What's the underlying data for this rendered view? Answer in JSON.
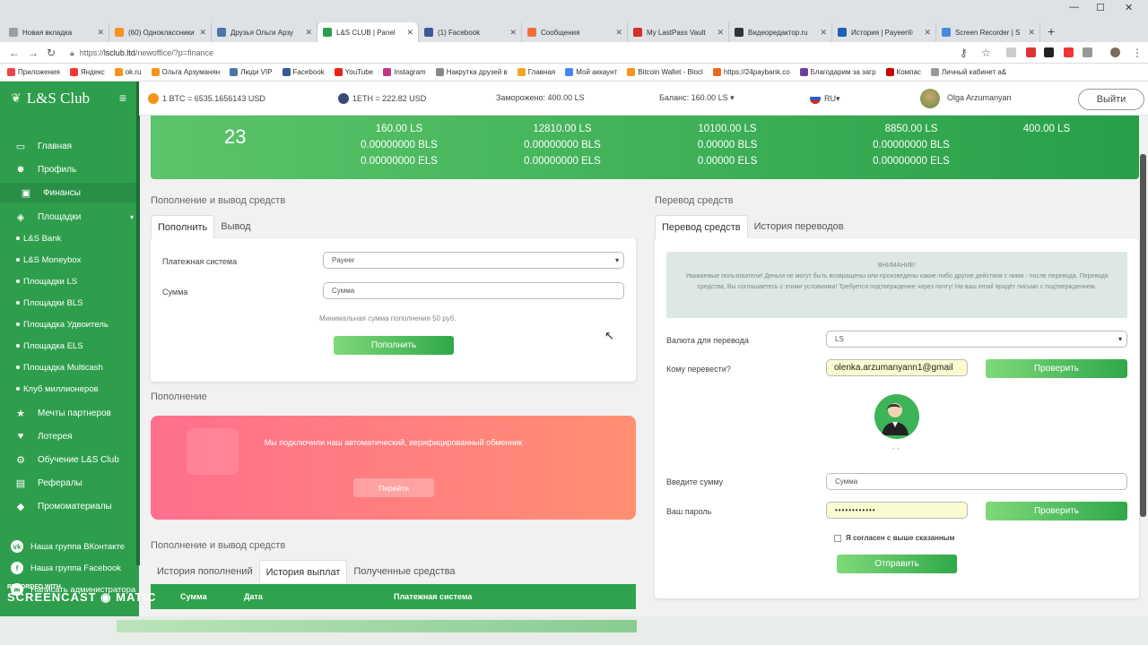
{
  "browser": {
    "tabs": [
      {
        "title": "Новая вкладка",
        "color": "#9e9e9e"
      },
      {
        "title": "(60) Одноклассники",
        "color": "#f7931e"
      },
      {
        "title": "Друзья Ольги Арзу",
        "color": "#4a76a8"
      },
      {
        "title": "L&S CLUB | Panel",
        "color": "#2e9e4d"
      },
      {
        "title": "(1) Facebook",
        "color": "#3b5998"
      },
      {
        "title": "Сообщения",
        "color": "#f36f3a"
      },
      {
        "title": "My LastPass Vault",
        "color": "#d32d27"
      },
      {
        "title": "Видеоредактор.ru",
        "color": "#333333"
      },
      {
        "title": "История | Payeer®",
        "color": "#1f5fb8"
      },
      {
        "title": "Screen Recorder | S",
        "color": "#4a8ad8"
      }
    ],
    "new_tab": "+",
    "url_prefix": "https://",
    "url_host": "lsclub.ltd",
    "url_path": "/newoffice/?p=finance",
    "bookmarks": [
      {
        "label": "Приложения",
        "color": "#e44"
      },
      {
        "label": "Яндекс",
        "color": "#f33"
      },
      {
        "label": "ok.ru",
        "color": "#f7931e"
      },
      {
        "label": "Ольга Арзуманян",
        "color": "#f7931e"
      },
      {
        "label": "Люди VIP",
        "color": "#4a76a8"
      },
      {
        "label": "Facebook",
        "color": "#3b5998"
      },
      {
        "label": "YouTube",
        "color": "#e62117"
      },
      {
        "label": "Instagram",
        "color": "#c13584"
      },
      {
        "label": "Накрутка друзей в",
        "color": "#888"
      },
      {
        "label": "Главная",
        "color": "#f5a623"
      },
      {
        "label": "Мой аккаунт",
        "color": "#4285f4"
      },
      {
        "label": "Bitcoin Wallet - Blocl",
        "color": "#f7931a"
      },
      {
        "label": "https://24paybank.co",
        "color": "#e86a1c"
      },
      {
        "label": "Благодарим за загр",
        "color": "#6b3fa0"
      },
      {
        "label": "Компас",
        "color": "#c00"
      },
      {
        "label": "Личный кабинет a&",
        "color": "#999"
      }
    ]
  },
  "app": {
    "logo": "L&S Club",
    "menu": [
      {
        "label": "Главная",
        "icon": "monitor-icon",
        "glyph": "▭"
      },
      {
        "label": "Профиль",
        "icon": "user-icon",
        "glyph": "☻"
      },
      {
        "label": "Финансы",
        "icon": "wallet-icon",
        "glyph": "▣"
      },
      {
        "label": "Площадки",
        "icon": "layers-icon",
        "glyph": "◈"
      }
    ],
    "submenu": [
      "L&S Bank",
      "L&S Moneybox",
      "Площадки LS",
      "Площадки BLS",
      "Площадка Удвоитель",
      "Площадка ELS",
      "Площадка Multicash",
      "Клуб миллионеров"
    ],
    "menu2": [
      {
        "label": "Мечты партнеров",
        "icon": "star-icon",
        "glyph": "★"
      },
      {
        "label": "Лотерея",
        "icon": "heart-icon",
        "glyph": "♥"
      },
      {
        "label": "Обучение L&S Club",
        "icon": "gear-icon",
        "glyph": "⚙"
      },
      {
        "label": "Рефералы",
        "icon": "users-icon",
        "glyph": "▤"
      },
      {
        "label": "Промоматериалы",
        "icon": "tag-icon",
        "glyph": "◆"
      }
    ],
    "social": [
      {
        "label": "Наша группа ВКонтакте",
        "icon": "vk-icon",
        "glyph": "vk"
      },
      {
        "label": "Наша группа Facebook",
        "icon": "facebook-icon",
        "glyph": "f"
      },
      {
        "label": "Написать администратора",
        "icon": "chat-icon",
        "glyph": "✉"
      }
    ]
  },
  "header": {
    "btc": "1 BTC = 6535.1656143 USD",
    "eth": "1ETH = 222.82 USD",
    "frozen": "Заморожено: 400.00 LS",
    "balance": "Баланс: 160.00 LS ▾",
    "lang": "RU▾",
    "user": "Olga Arzumanyan",
    "logout": "Выйти"
  },
  "stats": {
    "count": "23",
    "columns": [
      [
        "160.00 LS",
        "0.00000000 BLS",
        "0.00000000 ELS"
      ],
      [
        "12810.00 LS",
        "0.00000000 BLS",
        "0.00000000 ELS"
      ],
      [
        "10100.00 LS",
        "0.00000 BLS",
        "0.00000 ELS"
      ],
      [
        "8850.00 LS",
        "0.00000000 BLS",
        "0.00000000 ELS"
      ],
      [
        "400.00 LS",
        "",
        ""
      ]
    ]
  },
  "deposit": {
    "section_title": "Пополнение и вывод средств",
    "tab_deposit": "Пополнить",
    "tab_withdraw": "Вывод",
    "payment_label": "Платежная система",
    "payment_value": "Payeer",
    "amount_label": "Сумма",
    "amount_placeholder": "Сумма",
    "min_note": "Минимальная сумма пополнения 50 руб.",
    "submit": "Пополнить"
  },
  "exchanger": {
    "section_title": "Пополнение",
    "message": "Мы подключили наш автоматический, верифицированный обменник",
    "button": "Перейти"
  },
  "history": {
    "section_title": "Пополнение и вывод средств",
    "tabs": [
      "История пополнений",
      "История выплат",
      "Полученные средства"
    ],
    "columns": [
      "Сумма",
      "Дата",
      "Платежная система"
    ]
  },
  "transfer": {
    "section_title": "Перевод средств",
    "tab_transfer": "Перевод средств",
    "tab_history": "История переводов",
    "warn_title": "ВНИМАНИЕ!",
    "warn_text": "Уважаемые пользователи! Деньги не могут быть возвращены или произведены какие-либо другие действия с ними - после перевода. Переводя средства, Вы соглашаетесь с этими условиями! Требуется подтверждение через почту! На ваш email придёт письмо с подтверждением.",
    "currency_label": "Валюта для перевода",
    "currency_value": "LS",
    "to_label": "Кому перевести?",
    "to_value": "olenka.arzumanyann1@gmail",
    "check": "Проверить",
    "recipient_name": "- -",
    "amount_label": "Введите сумму",
    "amount_placeholder": "Сумма",
    "password_label": "Ваш пароль",
    "password_value": "••••••••••••",
    "check2": "Проверить",
    "agree": "Я согласен с выше сказанным",
    "send": "Отправить"
  },
  "watermark": {
    "top": "RECORDED WITH",
    "bottom": "SCREENCAST ◉ MATIC"
  }
}
